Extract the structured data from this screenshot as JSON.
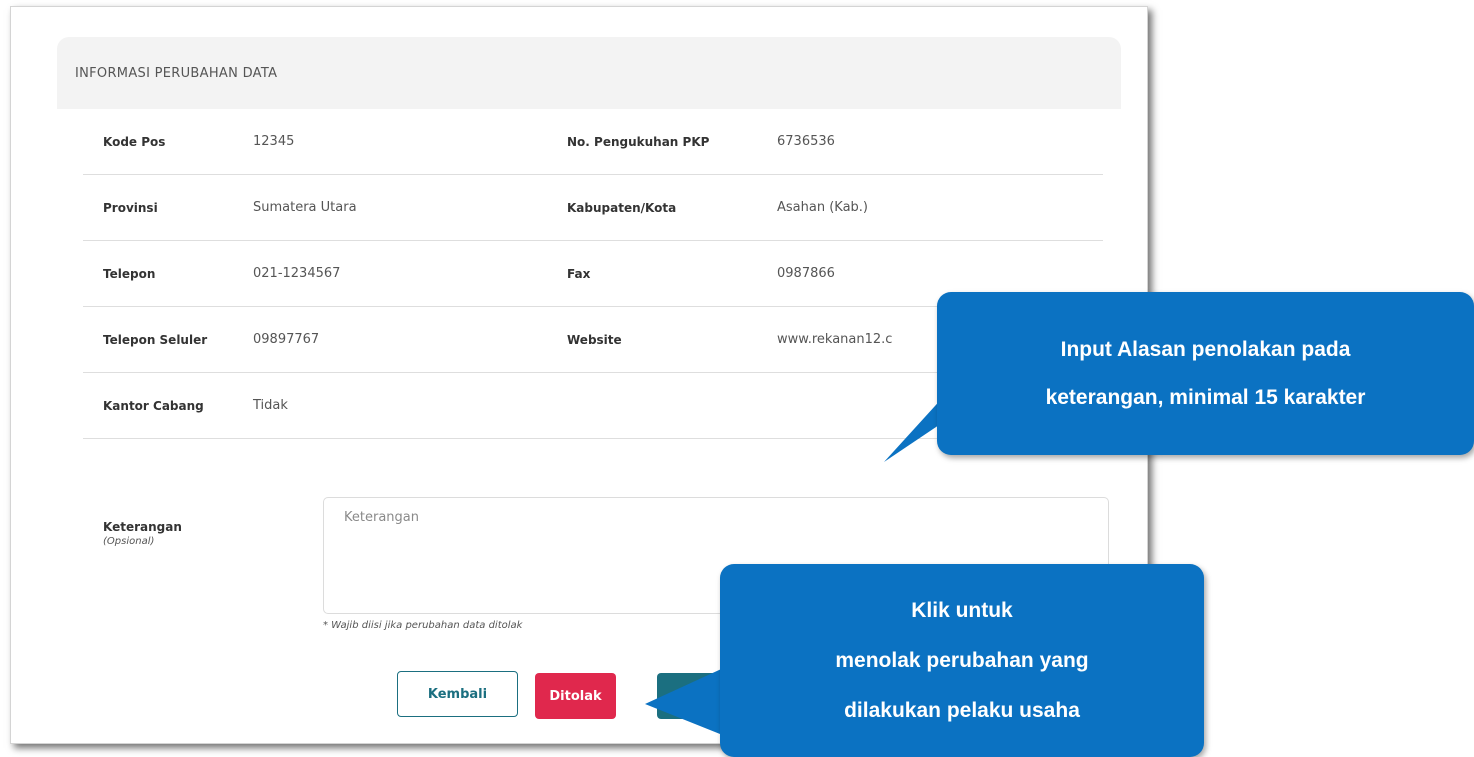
{
  "card": {
    "header_title": "INFORMASI PERUBAHAN DATA"
  },
  "fields": [
    {
      "label": "Kode Pos",
      "value": "12345",
      "label2": "No. Pengukuhan PKP",
      "value2": "6736536"
    },
    {
      "label": "Provinsi",
      "value": "Sumatera Utara",
      "label2": "Kabupaten/Kota",
      "value2": "Asahan (Kab.)"
    },
    {
      "label": "Telepon",
      "value": "021-1234567",
      "label2": "Fax",
      "value2": "0987866"
    },
    {
      "label": "Telepon Seluler",
      "value": "09897767",
      "label2": "Website",
      "value2": "www.rekanan12.c"
    },
    {
      "label": "Kantor Cabang",
      "value": "Tidak",
      "label2": "",
      "value2": ""
    }
  ],
  "keterangan": {
    "label": "Keterangan",
    "sub_label": "(Opsional)",
    "placeholder": "Keterangan",
    "hint": "* Wajib diisi jika perubahan data ditolak"
  },
  "buttons": {
    "back": "Kembali",
    "reject": "Ditolak"
  },
  "callouts": {
    "input": {
      "line1": "Input Alasan penolakan pada",
      "line2": "keterangan, minimal 15 karakter"
    },
    "reject": {
      "line1": "Klik untuk",
      "line2": "menolak perubahan yang",
      "line3": "dilakukan pelaku usaha"
    }
  },
  "colors": {
    "callout": "#0b72c2",
    "reject_button": "#e0284d",
    "primary": "#1b6f80",
    "header_bg": "#f3f3f3"
  }
}
